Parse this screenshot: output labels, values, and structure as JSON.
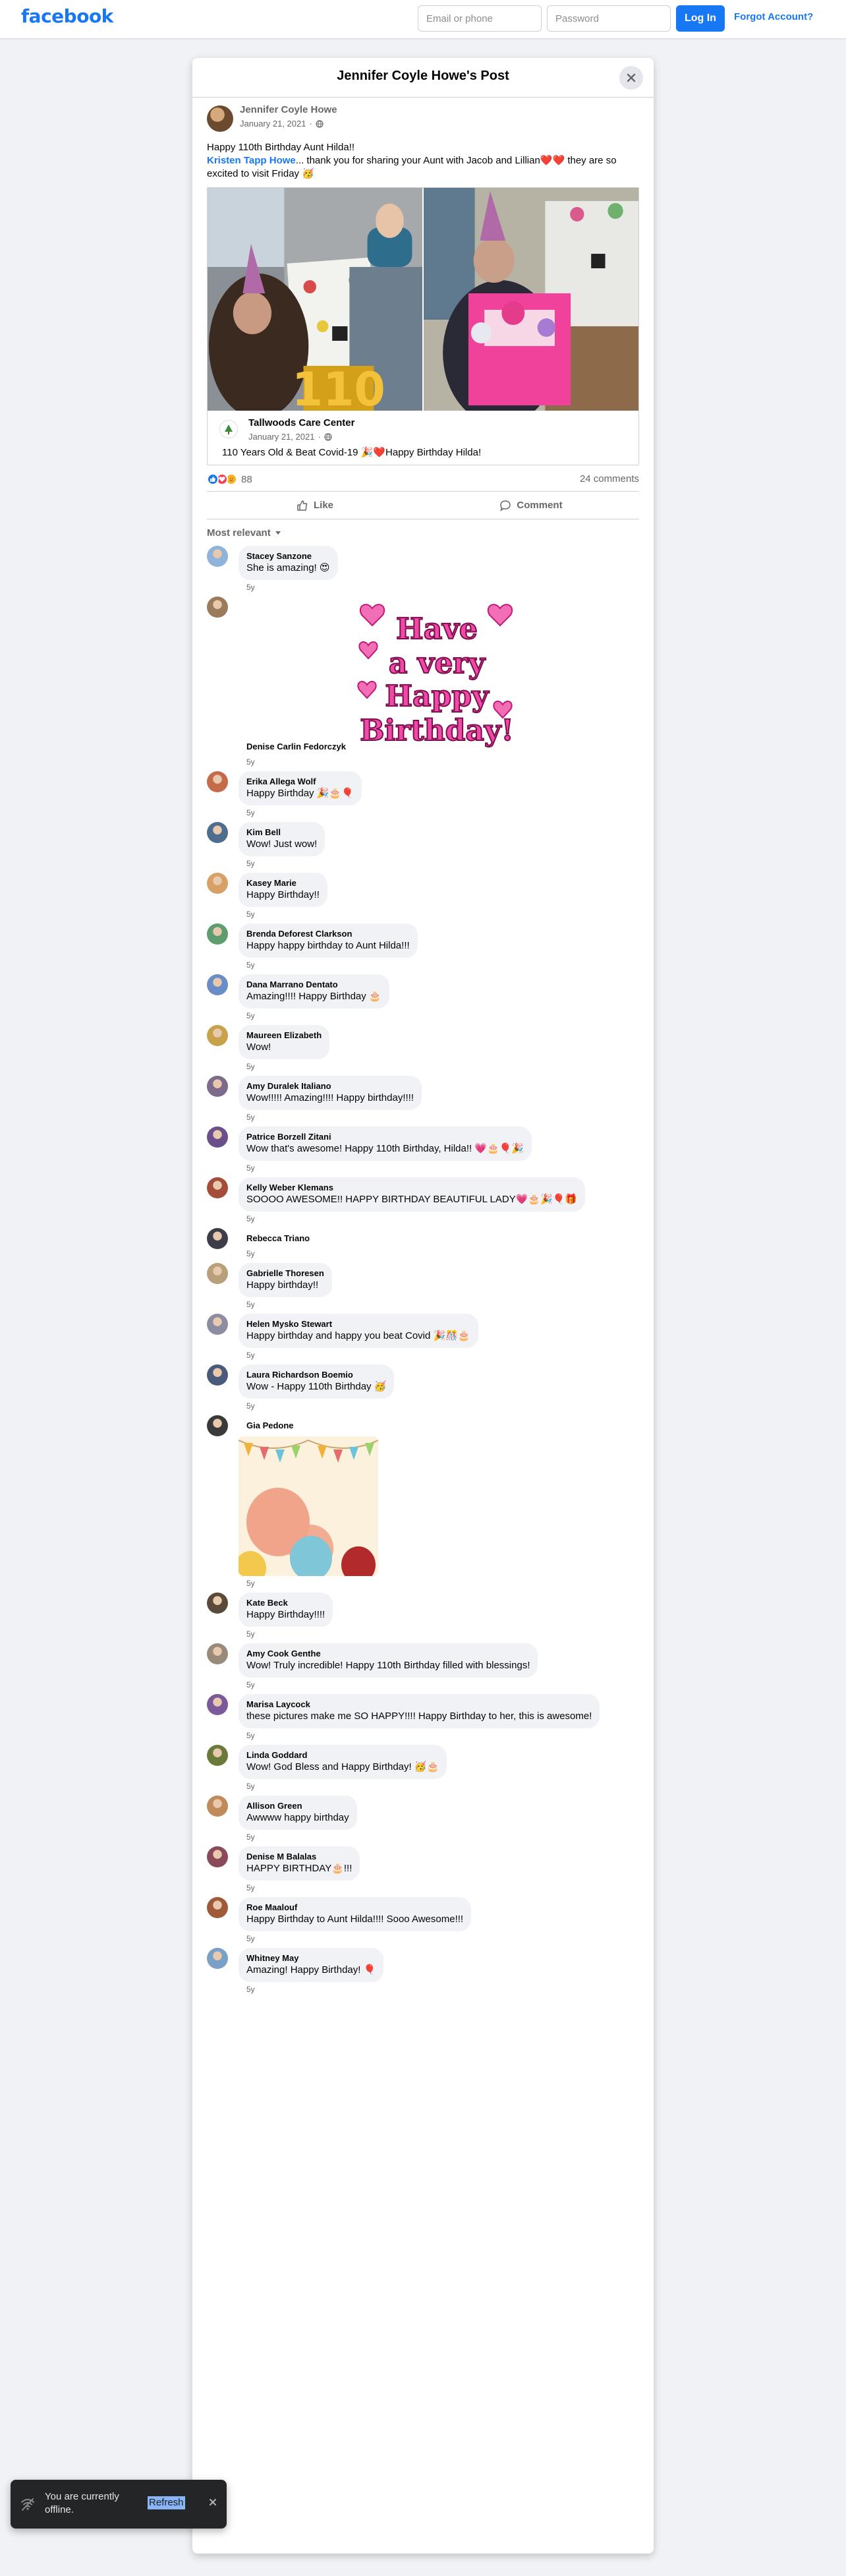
{
  "header": {
    "logo": "facebook",
    "email_placeholder": "Email or phone",
    "password_placeholder": "Password",
    "login_label": "Log In",
    "forgot_label": "Forgot Account?"
  },
  "modal": {
    "title": "Jennifer Coyle Howe's Post"
  },
  "post": {
    "author": "Jennifer Coyle Howe",
    "date": "January 21, 2021",
    "line1": "Happy 110th Birthday Aunt Hilda!!",
    "mention": "Kristen Tapp Howe",
    "line2": "... thank you for sharing your Aunt with Jacob and Lillian❤️❤️ they are so excited to visit Friday 🥳",
    "shared": {
      "page_name": "Tallwoods Care Center",
      "date": "January 21, 2021",
      "text": "110 Years Old & Beat Covid-19 🎉❤️Happy Birthday Hilda!"
    },
    "reaction_count": "88",
    "comment_count": "24 comments",
    "like_label": "Like",
    "comment_label": "Comment",
    "sort_label": "Most relevant"
  },
  "comments": [
    {
      "name": "Stacey Sanzone",
      "text": "She is amazing! 😍",
      "time": "5y"
    },
    {
      "name": "Denise Carlin Fedorczyk",
      "text": "",
      "time": "5y",
      "sticker": "Have a very Happy Birthday!"
    },
    {
      "name": "Erika Allega Wolf",
      "text": "Happy Birthday 🎉🎂🎈",
      "time": "5y"
    },
    {
      "name": "Kim Bell",
      "text": "Wow! Just wow!",
      "time": "5y"
    },
    {
      "name": "Kasey Marie",
      "text": "Happy Birthday!!",
      "time": "5y"
    },
    {
      "name": "Brenda Deforest Clarkson",
      "text": "Happy happy birthday to Aunt Hilda!!!",
      "time": "5y"
    },
    {
      "name": "Dana Marrano Dentato",
      "text": "Amazing!!!! Happy Birthday 🎂",
      "time": "5y"
    },
    {
      "name": "Maureen Elizabeth",
      "text": "Wow!",
      "time": "5y"
    },
    {
      "name": "Amy Duralek Italiano",
      "text": "Wow!!!!! Amazing!!!! Happy birthday!!!!",
      "time": "5y"
    },
    {
      "name": "Patrice Borzell Zitani",
      "text": "Wow that's awesome! Happy 110th Birthday, Hilda!! 💗🎂🎈🎉",
      "time": "5y"
    },
    {
      "name": "Kelly Weber Klemans",
      "text": "SOOOO AWESOME!! HAPPY BIRTHDAY BEAUTIFUL LADY💗🎂🎉🎈🎁",
      "time": "5y"
    },
    {
      "name": "Rebecca Triano",
      "text": "",
      "time": "5y"
    },
    {
      "name": "Gabrielle Thoresen",
      "text": "Happy birthday!!",
      "time": "5y"
    },
    {
      "name": "Helen Mysko Stewart",
      "text": "Happy birthday and happy you beat Covid 🎉🎊🎂",
      "time": "5y"
    },
    {
      "name": "Laura Richardson Boemio",
      "text": "Wow - Happy 110th Birthday 🥳",
      "time": "5y"
    },
    {
      "name": "Gia Pedone",
      "text": "",
      "time": "5y",
      "gif": true
    },
    {
      "name": "Kate Beck",
      "text": "Happy Birthday!!!!",
      "time": "5y"
    },
    {
      "name": "Amy Cook Genthe",
      "text": "Wow! Truly incredible! Happy 110th Birthday filled with blessings!",
      "time": "5y"
    },
    {
      "name": "Marisa Laycock",
      "text": "these pictures make me SO HAPPY!!!! Happy Birthday to her, this is awesome!",
      "time": "5y"
    },
    {
      "name": "Linda Goddard",
      "text": "Wow! God Bless and Happy Birthday! 🥳🎂",
      "time": "5y"
    },
    {
      "name": "Allison Green",
      "text": "Awwww happy birthday",
      "time": "5y"
    },
    {
      "name": "Denise M Balalas",
      "text": "HAPPY BIRTHDAY🎂!!!",
      "time": "5y"
    },
    {
      "name": "Roe Maalouf",
      "text": "Happy Birthday to Aunt Hilda!!!! Sooo Awesome!!!",
      "time": "5y"
    },
    {
      "name": "Whitney May",
      "text": "Amazing! Happy Birthday! 🎈",
      "time": "5y"
    }
  ],
  "toast": {
    "text": "You are currently offline.",
    "refresh_label": "Refresh"
  },
  "colors": {
    "brand": "#1877f2",
    "page_bg": "#f0f2f5",
    "bubble_bg": "#f0f2f5",
    "muted_text": "#65676b"
  }
}
